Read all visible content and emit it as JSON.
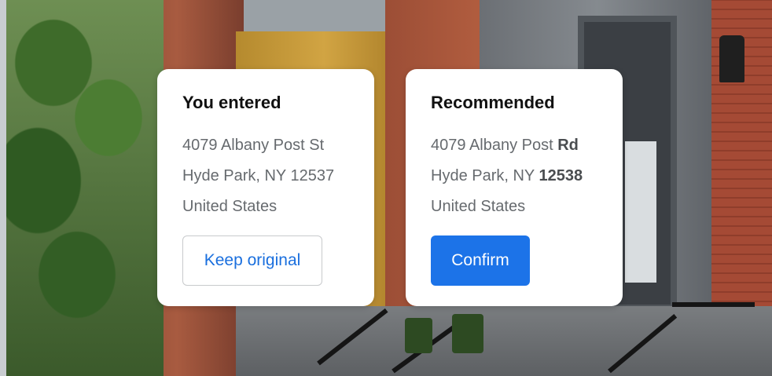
{
  "entered_card": {
    "title": "You entered",
    "line1": "4079 Albany Post St",
    "line2": "Hyde Park, NY 12537",
    "line3": "United States",
    "button_label": "Keep original"
  },
  "recommended_card": {
    "title": "Recommended",
    "line1_prefix": "4079 Albany Post ",
    "line1_changed": "Rd",
    "line2_prefix": "Hyde Park, NY ",
    "line2_changed": "12538",
    "line3": "United States",
    "button_label": "Confirm"
  },
  "colors": {
    "primary": "#1c73e8",
    "link_text": "#1a6fde",
    "card_background": "#ffffff"
  }
}
